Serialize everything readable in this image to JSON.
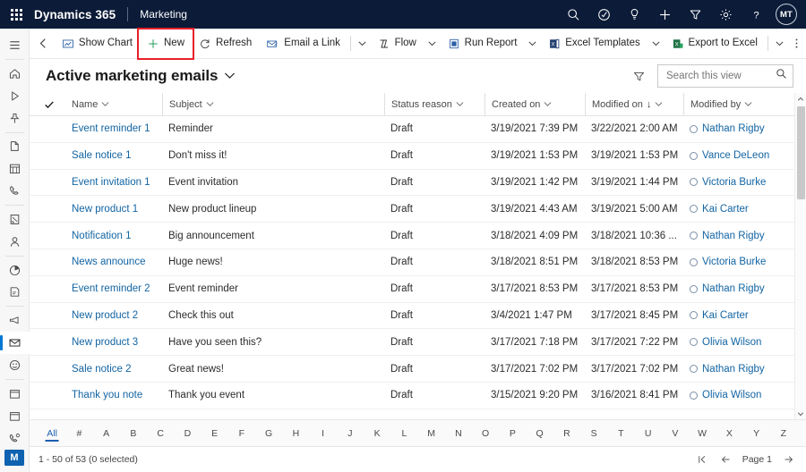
{
  "topnav": {
    "waffle_label": "App launcher",
    "brand": "Dynamics 365",
    "app_name": "Marketing",
    "icons": [
      {
        "name": "search-icon",
        "label": "Search"
      },
      {
        "name": "assistant-icon",
        "label": "Assistant"
      },
      {
        "name": "lightbulb-icon",
        "label": "Insights"
      },
      {
        "name": "add-icon",
        "label": "Quick create"
      },
      {
        "name": "filter-icon",
        "label": "Filter"
      },
      {
        "name": "gear-icon",
        "label": "Settings"
      },
      {
        "name": "help-icon",
        "label": "Help"
      }
    ],
    "avatar_initials": "MT",
    "bg_color": "#0b1b38"
  },
  "sidebar": {
    "items": [
      {
        "name": "site-map-icon",
        "label": "Site Map"
      },
      {
        "name": "home-icon",
        "label": "Home"
      },
      {
        "name": "recent-icon",
        "label": "Recent"
      },
      {
        "name": "pinned-icon",
        "label": "Pinned"
      },
      {
        "name": "documents-icon",
        "label": "Documents"
      },
      {
        "name": "calendar-icon",
        "label": "Calendar"
      },
      {
        "name": "phone-icon",
        "label": "Phone Calls"
      },
      {
        "name": "notes-icon",
        "label": "Notes"
      },
      {
        "name": "contacts-icon",
        "label": "Contacts"
      },
      {
        "name": "analytics-icon",
        "label": "Analytics"
      },
      {
        "name": "forms-icon",
        "label": "Forms"
      },
      {
        "name": "campaign-icon",
        "label": "Campaigns"
      },
      {
        "name": "email-icon",
        "label": "Marketing emails"
      },
      {
        "name": "customer-voice-icon",
        "label": "Customer Voice"
      },
      {
        "name": "events-icon",
        "label": "Events"
      },
      {
        "name": "segments-icon",
        "label": "Segments"
      },
      {
        "name": "calls-icon",
        "label": "Calls"
      }
    ],
    "selected_index": 12,
    "bottom_badge": "M",
    "accent_color": "#0078d4"
  },
  "commandbar": {
    "back_label": "Back",
    "commands": [
      {
        "name": "show-chart-button",
        "label": "Show Chart",
        "icon": "chart-icon",
        "caret": false
      },
      {
        "name": "new-button",
        "label": "New",
        "icon": "plus-icon",
        "caret": false,
        "highlighted": true
      },
      {
        "name": "refresh-button",
        "label": "Refresh",
        "icon": "refresh-icon",
        "caret": false
      },
      {
        "name": "email-a-link-button",
        "label": "Email a Link",
        "icon": "email-link-icon",
        "caret": true,
        "divider_before_caret": true
      },
      {
        "name": "flow-button",
        "label": "Flow",
        "icon": "flow-icon",
        "caret": true
      },
      {
        "name": "run-report-button",
        "label": "Run Report",
        "icon": "report-icon",
        "caret": true
      },
      {
        "name": "excel-templates-button",
        "label": "Excel Templates",
        "icon": "excel-template-icon",
        "caret": true
      },
      {
        "name": "export-to-excel-button",
        "label": "Export to Excel",
        "icon": "excel-export-icon",
        "caret": true,
        "divider_before_caret": true
      }
    ],
    "overflow_label": "More commands",
    "highlight_color": "#e8202a"
  },
  "view": {
    "title": "Active marketing emails",
    "filter_label": "Edit filters",
    "search": {
      "placeholder": "Search this view",
      "value": ""
    }
  },
  "grid": {
    "select_all_label": "Select all",
    "columns": [
      {
        "name": "column-name",
        "label": "Name",
        "sorted": false
      },
      {
        "name": "column-subject",
        "label": "Subject",
        "sorted": false
      },
      {
        "name": "column-status-reason",
        "label": "Status reason",
        "sorted": false
      },
      {
        "name": "column-created-on",
        "label": "Created on",
        "sorted": false
      },
      {
        "name": "column-modified-on",
        "label": "Modified on",
        "sorted": true,
        "sort_dir": "↓"
      },
      {
        "name": "column-modified-by",
        "label": "Modified by",
        "sorted": false
      }
    ],
    "rows": [
      {
        "name": "Event reminder 1",
        "subject": "Reminder",
        "status": "Draft",
        "created": "3/19/2021 7:39 PM",
        "modified": "3/22/2021 2:00 AM",
        "modified_by": "Nathan Rigby"
      },
      {
        "name": "Sale notice 1",
        "subject": "Don't miss it!",
        "status": "Draft",
        "created": "3/19/2021 1:53 PM",
        "modified": "3/19/2021 1:53 PM",
        "modified_by": "Vance DeLeon"
      },
      {
        "name": "Event invitation 1",
        "subject": "Event invitation",
        "status": "Draft",
        "created": "3/19/2021 1:42 PM",
        "modified": "3/19/2021 1:44 PM",
        "modified_by": "Victoria Burke"
      },
      {
        "name": "New product 1",
        "subject": "New product lineup",
        "status": "Draft",
        "created": "3/19/2021 4:43 AM",
        "modified": "3/19/2021 5:00 AM",
        "modified_by": "Kai Carter"
      },
      {
        "name": "Notification 1",
        "subject": "Big announcement",
        "status": "Draft",
        "created": "3/18/2021 4:09 PM",
        "modified": "3/18/2021 10:36 ...",
        "modified_by": "Nathan Rigby"
      },
      {
        "name": "News announce",
        "subject": "Huge news!",
        "status": "Draft",
        "created": "3/18/2021 8:51 PM",
        "modified": "3/18/2021 8:53 PM",
        "modified_by": "Victoria Burke"
      },
      {
        "name": "Event reminder 2",
        "subject": "Event reminder",
        "status": "Draft",
        "created": "3/17/2021 8:53 PM",
        "modified": "3/17/2021 8:53 PM",
        "modified_by": "Nathan Rigby"
      },
      {
        "name": "New product 2",
        "subject": "Check this out",
        "status": "Draft",
        "created": "3/4/2021 1:47 PM",
        "modified": "3/17/2021 8:45 PM",
        "modified_by": "Kai Carter"
      },
      {
        "name": "New product 3",
        "subject": "Have you seen this?",
        "status": "Draft",
        "created": "3/17/2021 7:18 PM",
        "modified": "3/17/2021 7:22 PM",
        "modified_by": "Olivia Wilson"
      },
      {
        "name": "Sale notice 2",
        "subject": "Great news!",
        "status": "Draft",
        "created": "3/17/2021 7:02 PM",
        "modified": "3/17/2021 7:02 PM",
        "modified_by": "Nathan Rigby"
      },
      {
        "name": "Thank you note",
        "subject": "Thank you event",
        "status": "Draft",
        "created": "3/15/2021 9:20 PM",
        "modified": "3/16/2021 8:41 PM",
        "modified_by": "Olivia Wilson"
      }
    ]
  },
  "alphabar": {
    "selected": "All",
    "letters": [
      "All",
      "#",
      "A",
      "B",
      "C",
      "D",
      "E",
      "F",
      "G",
      "H",
      "I",
      "J",
      "K",
      "L",
      "M",
      "N",
      "O",
      "P",
      "Q",
      "R",
      "S",
      "T",
      "U",
      "V",
      "W",
      "X",
      "Y",
      "Z"
    ]
  },
  "statusbar": {
    "record_count": "1 - 50 of 53 (0 selected)",
    "page_label": "Page 1",
    "first_page_label": "First page",
    "prev_page_label": "Previous page",
    "next_page_label": "Next page"
  }
}
